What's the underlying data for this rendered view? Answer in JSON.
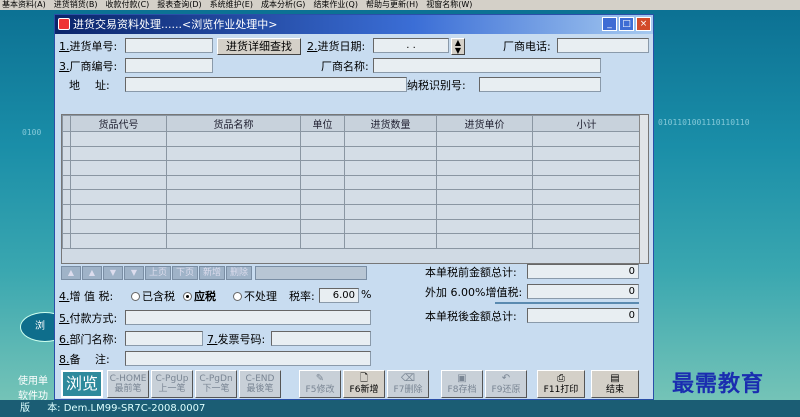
{
  "menu": [
    "基本资料(A)",
    "进货销货(B)",
    "收款付款(C)",
    "报表查询(D)",
    "系统维护(E)",
    "成本分析(G)",
    "结束作业(Q)",
    "帮助与更新(H)",
    "视窗名称(W)"
  ],
  "background": {
    "binary_left": "0100",
    "binary_right": "0101101001110110110",
    "oval_label": "浏",
    "text_use": "使用单",
    "text_software": "软件功",
    "version_label": "版",
    "version_value": "本: Dem.LM99-SR7C-2008.0007"
  },
  "watermark": "最需教育",
  "window": {
    "title": "进货交易资料处理......<浏览作业处理中>",
    "buttons": [
      "_",
      "□",
      "×"
    ]
  },
  "form": {
    "order_no_num": "1.",
    "order_no_label": "进货单号:",
    "detail_search_button": "进货详细查找",
    "date_num": "2.",
    "date_label": "进货日期:",
    "date_value": ".   .",
    "vendor_phone_label": "厂商电话:",
    "vendor_code_num": "3.",
    "vendor_code_label": "厂商编号:",
    "vendor_name_label": "厂商名称:",
    "address_label1": "地",
    "address_label2": "址:",
    "tax_id_label": "纳税识别号:"
  },
  "grid": {
    "columns": [
      "货品代号",
      "货品名称",
      "单位",
      "进货数量",
      "进货单价",
      "小计"
    ],
    "row_count": 8
  },
  "nav": {
    "buttons": [
      "▲",
      "▲",
      "▼",
      "▼"
    ],
    "text_buttons": [
      "上页",
      "下页",
      "新增",
      "删除"
    ]
  },
  "tax": {
    "num": "4.",
    "label": "增 值 税:",
    "options": [
      "已含税",
      "应税",
      "不处理"
    ],
    "selected_index": 1,
    "rate_label": "税率:",
    "rate_value": "6.00",
    "rate_unit": "%"
  },
  "payment": {
    "num": "5.",
    "label": "付款方式:"
  },
  "dept": {
    "num": "6.",
    "label": "部门名称:"
  },
  "invoice": {
    "num": "7.",
    "label": "发票号码:"
  },
  "remark": {
    "num": "8.",
    "label1": "备",
    "label2": "注:"
  },
  "totals": {
    "pre_tax_label": "本单税前金额总计:",
    "pre_tax_value": "0",
    "vat_label": "外加 6.00%增值税:",
    "vat_value": "0",
    "post_tax_label": "本单税後金额总计:",
    "post_tax_value": "0"
  },
  "toolbar": {
    "browse": "浏览",
    "home_top": "C-HOME",
    "home_bottom": "最前笔",
    "pgup_top": "C-PgUp",
    "pgup_bottom": "上一笔",
    "pgdn_top": "C-PgDn",
    "pgdn_bottom": "下一笔",
    "end_top": "C-END",
    "end_bottom": "最後笔",
    "f5": "F5修改",
    "f6": "F6新增",
    "f7": "F7删除",
    "f8": "F8存档",
    "f9": "F9还原",
    "f11": "F11打印",
    "exit": "结束"
  },
  "colors": {
    "title_start": "#0a246a",
    "window_bg": "#c8dcf0",
    "browse_bg": "#2e8a9c"
  }
}
